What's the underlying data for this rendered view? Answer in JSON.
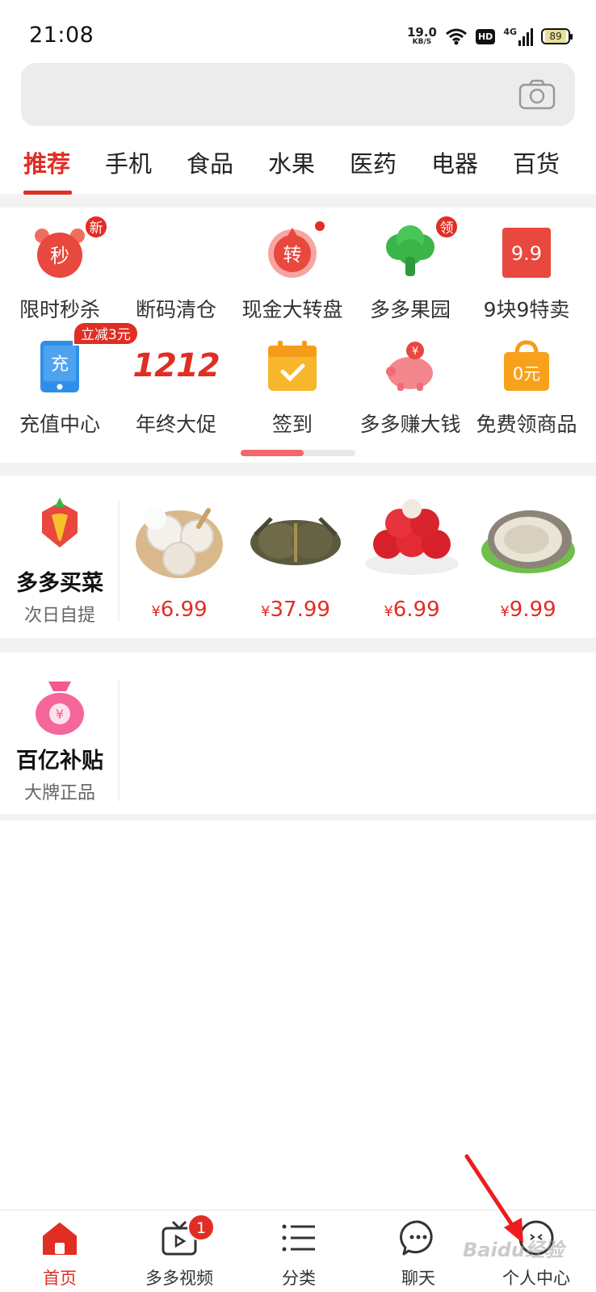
{
  "status_bar": {
    "time": "21:08",
    "net_speed": "19.0",
    "net_unit": "KB/S",
    "hd": "HD",
    "signal": "4G",
    "battery": "89"
  },
  "search": {
    "placeholder": "",
    "camera_icon": "camera-icon"
  },
  "category_tabs": [
    {
      "label": "推荐",
      "active": true
    },
    {
      "label": "手机"
    },
    {
      "label": "食品"
    },
    {
      "label": "水果"
    },
    {
      "label": "医药"
    },
    {
      "label": "电器"
    },
    {
      "label": "百货"
    }
  ],
  "quick_entries": [
    {
      "label": "限时秒杀",
      "icon_text": "秒",
      "badge": "新"
    },
    {
      "label": "断码清仓"
    },
    {
      "label": "现金大转盘",
      "icon_text": "转",
      "badge_dot": true
    },
    {
      "label": "多多果园",
      "badge": "领"
    },
    {
      "label": "9块9特卖",
      "icon_text": "9.9"
    },
    {
      "label": "充值中心",
      "icon_text": "充",
      "badge": "立减3元"
    },
    {
      "label": "年终大促",
      "icon_text": "1212"
    },
    {
      "label": "签到"
    },
    {
      "label": "多多赚大钱",
      "icon_text": "¥"
    },
    {
      "label": "免费领商品",
      "icon_text": "0元"
    }
  ],
  "grocery": {
    "title": "多多买菜",
    "subtitle": "次日自提",
    "products": [
      {
        "name": "coconut",
        "currency": "¥",
        "price": "6.99"
      },
      {
        "name": "crab",
        "currency": "¥",
        "price": "37.99"
      },
      {
        "name": "rambutan",
        "currency": "¥",
        "price": "6.99"
      },
      {
        "name": "oyster",
        "currency": "¥",
        "price": "9.99"
      }
    ]
  },
  "subsidy": {
    "title": "百亿补贴",
    "subtitle": "大牌正品",
    "icon_text": "¥"
  },
  "bottom_nav": [
    {
      "label": "首页",
      "active": true
    },
    {
      "label": "多多视频",
      "badge": "1"
    },
    {
      "label": "分类"
    },
    {
      "label": "聊天"
    },
    {
      "label": "个人中心"
    }
  ],
  "watermark": "Baidu经验",
  "colors": {
    "brand_red": "#e02e24",
    "tab_gray": "#ececec"
  }
}
